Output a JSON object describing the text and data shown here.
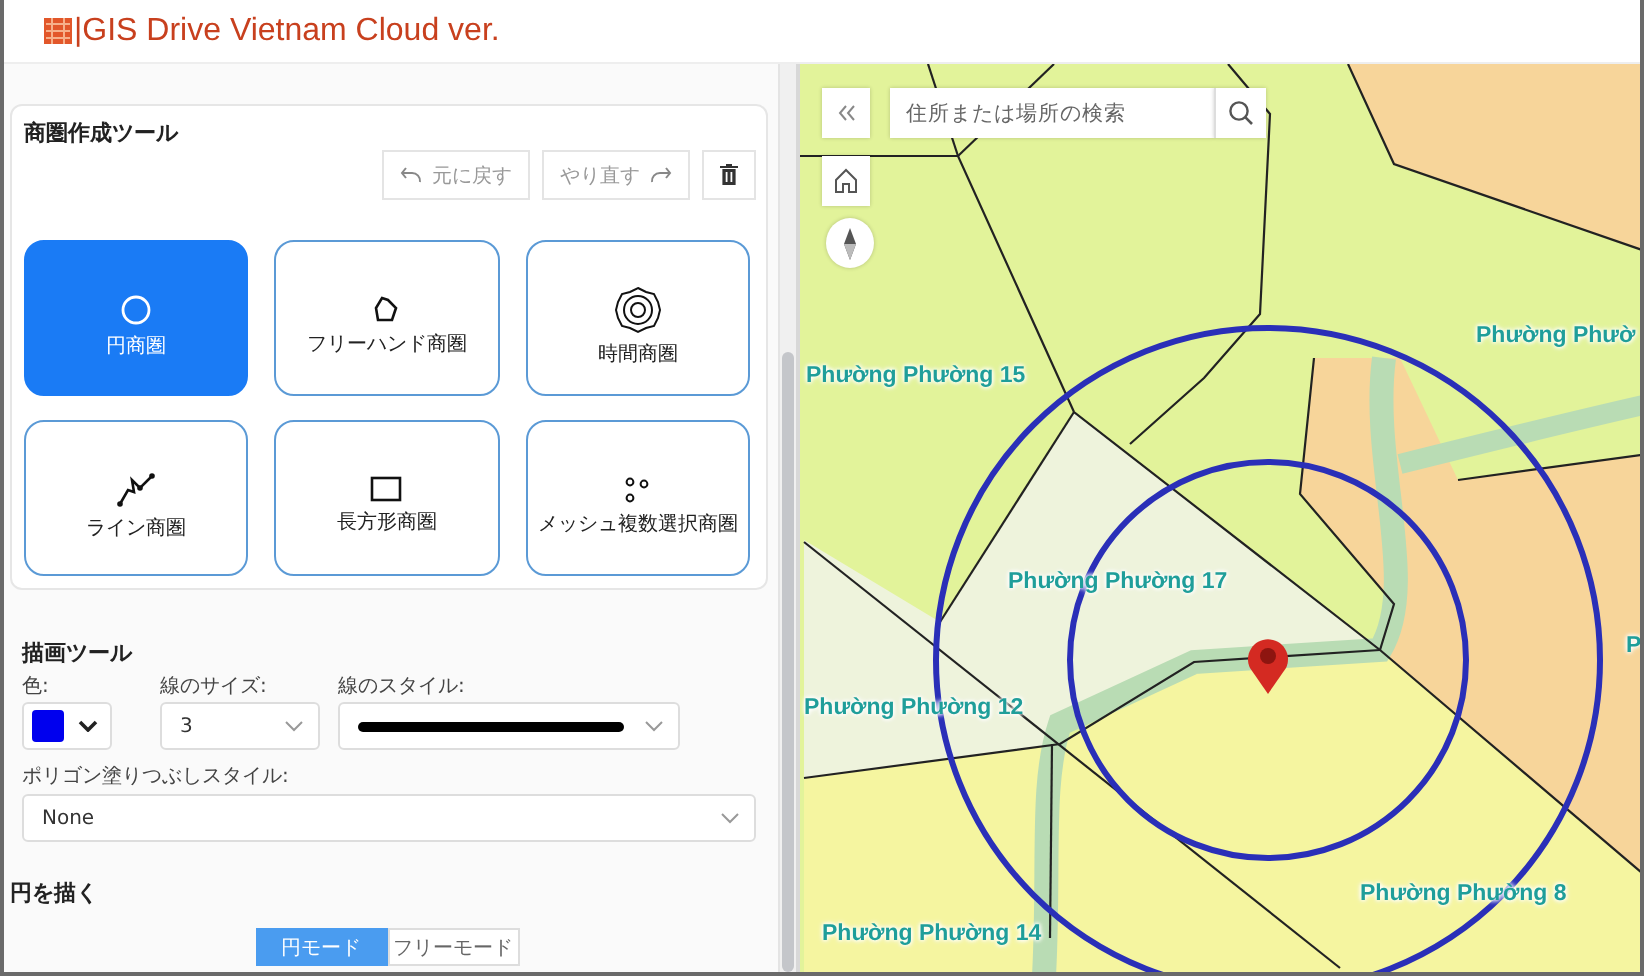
{
  "header": {
    "title": "|GIS Drive Vietnam Cloud ver."
  },
  "trade_area_tool": {
    "title": "商圏作成ツール",
    "undo": "元に戻す",
    "redo": "やり直す",
    "shapes": [
      {
        "label": "円商圏",
        "kind": "circle",
        "selected": true
      },
      {
        "label": "フリーハンド商圏",
        "kind": "freehand",
        "selected": false
      },
      {
        "label": "時間商圏",
        "kind": "time",
        "selected": false
      },
      {
        "label": "ライン商圏",
        "kind": "line",
        "selected": false
      },
      {
        "label": "長方形商圏",
        "kind": "rectangle",
        "selected": false
      },
      {
        "label": "メッシュ複数選択商圏",
        "kind": "mesh",
        "selected": false
      }
    ]
  },
  "drawing_tool": {
    "title": "描画ツール",
    "color_label": "色:",
    "color": "#0000ee",
    "size_label": "線のサイズ:",
    "size": "3",
    "style_label": "線のスタイル:",
    "fill_label": "ポリゴン塗りつぶしスタイル:",
    "fill": "None"
  },
  "draw_circle": {
    "title": "円を描く",
    "modes": [
      {
        "label": "円モード",
        "selected": true
      },
      {
        "label": "フリーモード",
        "selected": false
      }
    ]
  },
  "map": {
    "search": {
      "placeholder": "住所または場所の検索"
    },
    "labels": [
      {
        "text": "Phường Phường 15"
      },
      {
        "text": "Phường Phườ"
      },
      {
        "text": "Phường Phường 17"
      },
      {
        "text": "Phường Phường 12"
      },
      {
        "text": "P"
      },
      {
        "text": "Phường Phường 8"
      },
      {
        "text": "Phường Phường 14"
      }
    ]
  }
}
